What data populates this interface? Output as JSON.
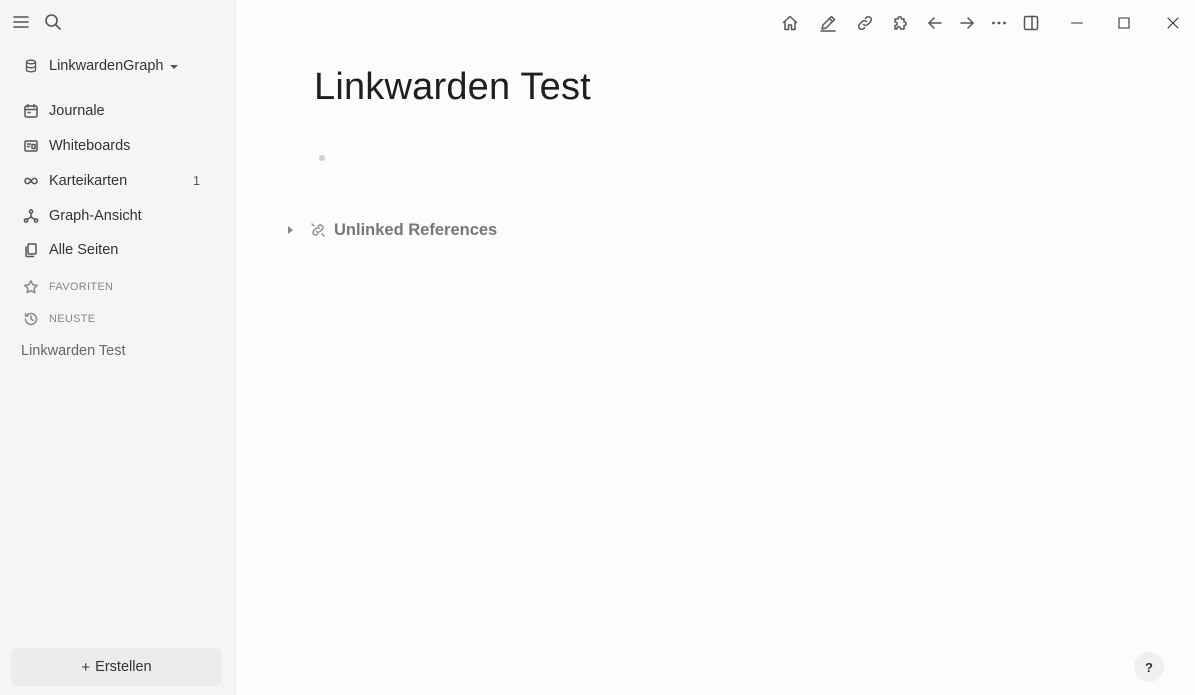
{
  "sidebar": {
    "graph_name": "LinkwardenGraph",
    "nav": [
      {
        "label": "Journale",
        "icon": "calendar-icon"
      },
      {
        "label": "Whiteboards",
        "icon": "whiteboard-icon"
      },
      {
        "label": "Karteikarten",
        "icon": "infinity-icon",
        "count": "1"
      },
      {
        "label": "Graph-Ansicht",
        "icon": "graph-icon"
      },
      {
        "label": "Alle Seiten",
        "icon": "pages-icon"
      }
    ],
    "favorites_label": "FAVORITEN",
    "recent_label": "NEUSTE",
    "recent_items": [
      "Linkwarden Test"
    ],
    "create_label": "Erstellen",
    "create_plus": "+"
  },
  "toolbar": {
    "icons": [
      "home-icon",
      "edit-icon",
      "link-icon",
      "puzzle-icon",
      "arrow-left-icon",
      "arrow-right-icon",
      "more-icon",
      "right-sidebar-icon",
      "minimize-icon",
      "maximize-icon",
      "close-icon"
    ]
  },
  "page": {
    "title": "Linkwarden Test",
    "unlinked_references_label": "Unlinked References"
  },
  "help_label": "?"
}
